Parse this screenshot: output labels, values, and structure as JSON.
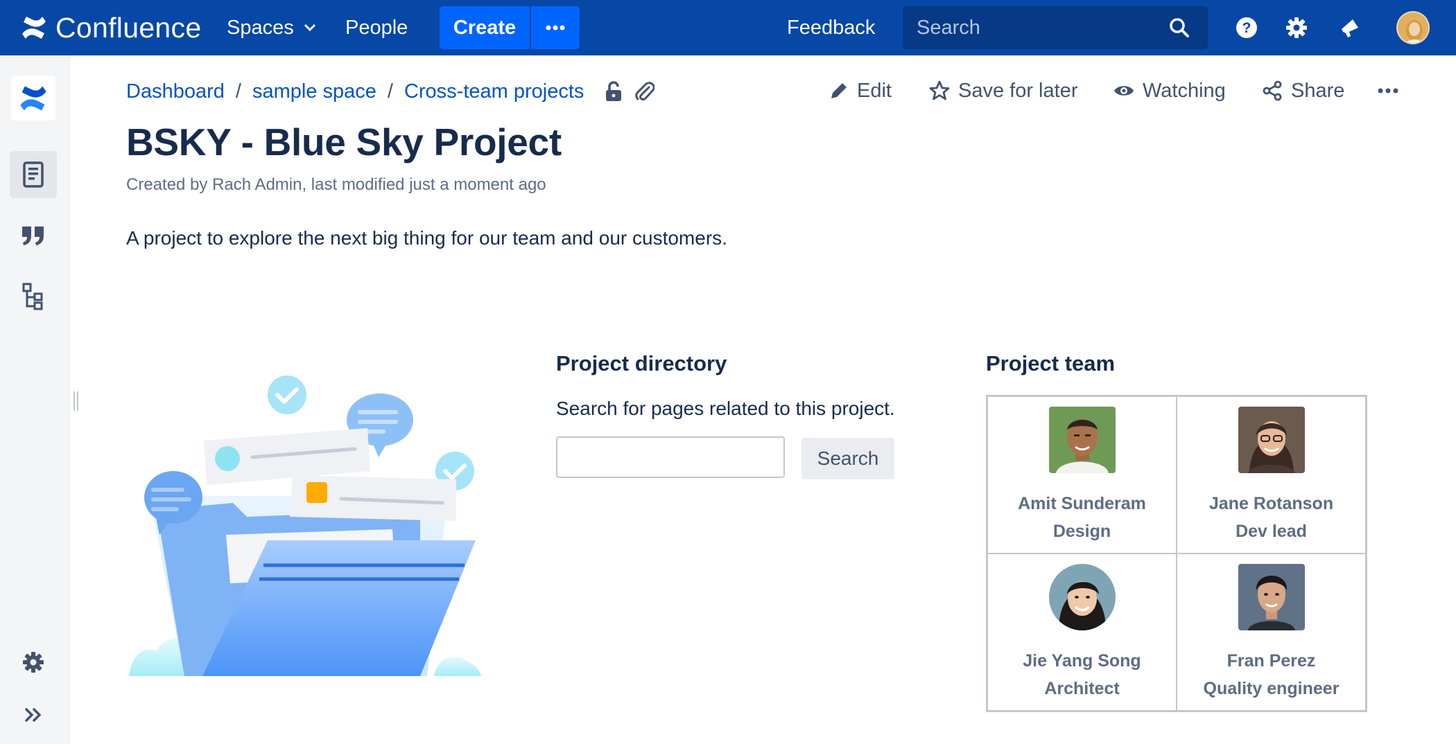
{
  "app": {
    "name": "Confluence"
  },
  "topnav": {
    "spaces_label": "Spaces",
    "people_label": "People",
    "create_label": "Create",
    "feedback_label": "Feedback",
    "search_placeholder": "Search",
    "bg_color": "#0747a6",
    "create_color": "#0065ff"
  },
  "breadcrumb": {
    "items": [
      "Dashboard",
      "sample space",
      "Cross-team projects"
    ],
    "separator": "/"
  },
  "actions": {
    "edit_label": "Edit",
    "save_label": "Save for later",
    "watch_label": "Watching",
    "share_label": "Share"
  },
  "page": {
    "title": "BSKY - Blue Sky Project",
    "byline": "Created by Rach Admin, last modified just a moment ago",
    "intro": "A project to explore the next big thing for our team and our customers."
  },
  "directory": {
    "title": "Project directory",
    "description": "Search for pages related to this project.",
    "input_value": "",
    "button_label": "Search"
  },
  "team": {
    "title": "Project team",
    "members": [
      {
        "name": "Amit Sunderam",
        "role": "Design"
      },
      {
        "name": "Jane Rotanson",
        "role": "Dev lead"
      },
      {
        "name": "Jie Yang Song",
        "role": "Architect"
      },
      {
        "name": "Fran Perez",
        "role": "Quality engineer"
      }
    ]
  },
  "icons": {
    "sidebar": [
      "confluence-logo-icon",
      "pages-icon",
      "blog-quote-icon",
      "page-tree-icon",
      "settings-icon",
      "expand-sidebar-icon"
    ],
    "topnav": [
      "help-icon",
      "settings-icon",
      "notifications-icon"
    ]
  }
}
